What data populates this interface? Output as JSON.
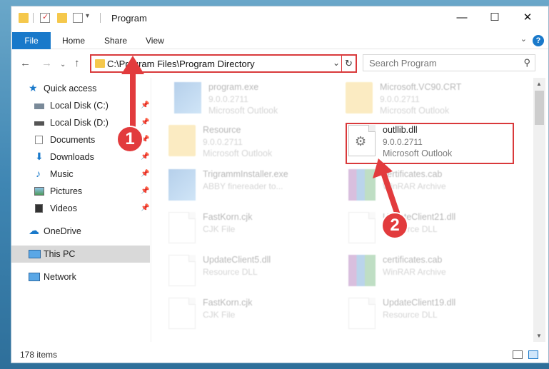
{
  "window": {
    "title": "Program",
    "controls": {
      "minimize": "—",
      "maximize": "☐",
      "close": "✕"
    }
  },
  "ribbon": {
    "tabs": [
      "File",
      "Home",
      "Share",
      "View"
    ]
  },
  "address": {
    "path": "C:\\Program Files\\Program Directory"
  },
  "search": {
    "placeholder": "Search Program"
  },
  "sidebar": {
    "items": [
      {
        "label": "Quick access"
      },
      {
        "label": "Local Disk (C:)"
      },
      {
        "label": "Local Disk (D:)"
      },
      {
        "label": "Documents"
      },
      {
        "label": "Downloads"
      },
      {
        "label": "Music"
      },
      {
        "label": "Pictures"
      },
      {
        "label": "Videos"
      },
      {
        "label": "OneDrive"
      },
      {
        "label": "This PC"
      },
      {
        "label": "Network"
      }
    ]
  },
  "files": [
    {
      "name": "program.exe",
      "version": "9.0.0.2711",
      "type": "Microsoft Outlook"
    },
    {
      "name": "Microsoft.VC90.CRT",
      "version": "9.0.0.2711",
      "type": "Microsoft Outlook"
    },
    {
      "name": "Resource",
      "version": "9.0.0.2711",
      "type": "Microsoft Outlook"
    },
    {
      "name": "outllib.dll",
      "version": "9.0.0.2711",
      "type": "Microsoft Outlook"
    },
    {
      "name": "TrigrammInstaller.exe",
      "version": "",
      "type": "ABBY finereader to..."
    },
    {
      "name": "certificates.cab",
      "version": "",
      "type": "WinRAR Archive"
    },
    {
      "name": "FastKorn.cjk",
      "version": "",
      "type": "CJK File"
    },
    {
      "name": "UpdateClient21.dll",
      "version": "",
      "type": "Resource DLL"
    },
    {
      "name": "UpdateClient5.dll",
      "version": "",
      "type": "Resource DLL"
    },
    {
      "name": "certificates.cab",
      "version": "",
      "type": "WinRAR Archive"
    },
    {
      "name": "FastKorn.cjk",
      "version": "",
      "type": "CJK File"
    },
    {
      "name": "UpdateClient19.dll",
      "version": "",
      "type": "Resource DLL"
    }
  ],
  "status": {
    "items": "178 items"
  },
  "annotations": {
    "step1": "1",
    "step2": "2"
  },
  "colors": {
    "highlight": "#d9393b",
    "accent": "#1979ca"
  }
}
